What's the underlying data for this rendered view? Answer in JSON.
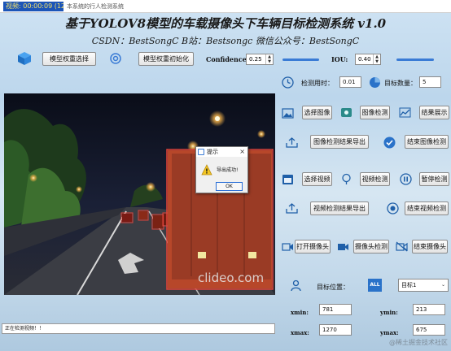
{
  "window": {
    "badge_text": "视频: 00:00:09 (12:00)",
    "title": "本系统的行人检测系统"
  },
  "header": {
    "title": "基于YOLOV8模型的车载摄像头下车辆目标检测系统 v1.0",
    "subtitle": "CSDN：BestSongC   B站：Bestsongc   微信公众号：BestSongC"
  },
  "toolbar": {
    "model_select_label": "模型权重选择",
    "model_init_label": "模型权重初始化",
    "confidence_label": "Confidence:",
    "confidence_value": "0.25",
    "confidence_level": 0.25,
    "iou_label": "IOU:",
    "iou_value": "0.40",
    "iou_level": 0.4
  },
  "stats": {
    "time_label": "检测用时：",
    "time_value": "0.01",
    "count_label": "目标数量：",
    "count_value": "5"
  },
  "image_panel": {
    "select_image": "选择图像",
    "detect_image": "图像检测",
    "show_result": "结果展示",
    "export_image_result": "图像检测结果导出",
    "end_image_detect": "结束图像检测"
  },
  "video_panel": {
    "select_video": "选择视频",
    "detect_video": "视频检测",
    "pause_detect": "暂停检测",
    "export_video_result": "视频检测结果导出",
    "end_video_detect": "结束视频检测"
  },
  "camera_panel": {
    "open_camera": "打开摄像头",
    "camera_detect": "摄像头检测",
    "close_camera": "结束摄像头"
  },
  "target": {
    "position_label": "目标位置：",
    "all_icon_text": "ALL",
    "target_select_value": "目标1",
    "xmin_label": "xmin:",
    "xmin_value": "781",
    "ymin_label": "ymin:",
    "ymin_value": "213",
    "xmax_label": "xmax:",
    "xmax_value": "1270",
    "ymax_label": "ymax:",
    "ymax_value": "675"
  },
  "dialog": {
    "title": "提示",
    "close": "×",
    "message": "导出成功!",
    "ok_label": "OK",
    "warning_mark": "!"
  },
  "viewport": {
    "watermark": "clideo.com"
  },
  "status_bar": {
    "text": "正在检测视频！！"
  },
  "page_watermark": "@稀土掘金技术社区",
  "colors": {
    "accent": "#3a7bd5",
    "detection_box": "#e0443a",
    "badge": "#1c55b8"
  }
}
